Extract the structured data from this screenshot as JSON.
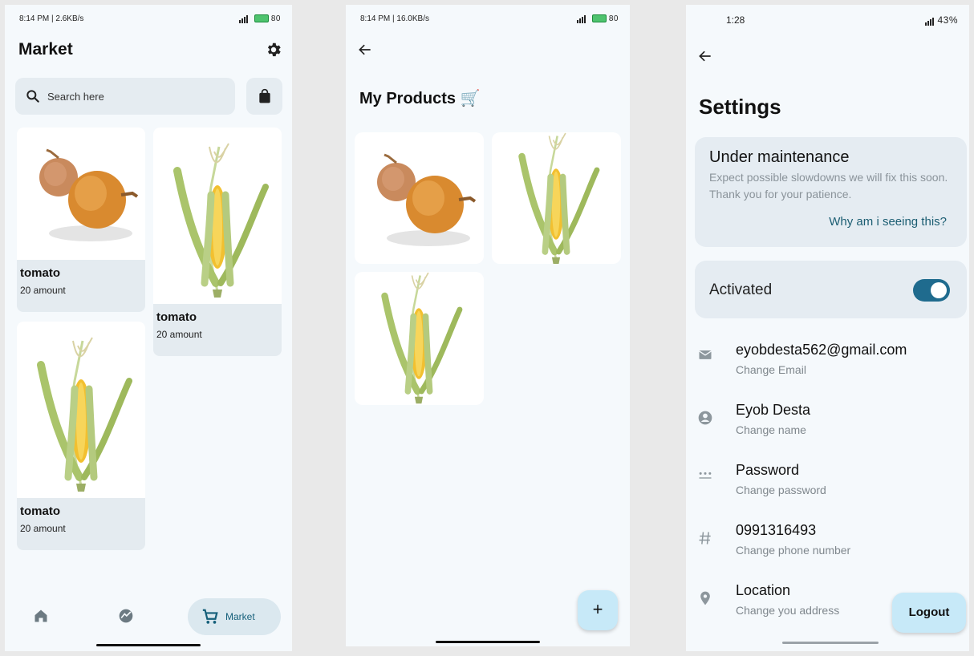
{
  "screens": {
    "market": {
      "status": {
        "left": "8:14 PM | 2.6KB/s",
        "right": "80"
      },
      "title": "Market",
      "search": {
        "placeholder": "Search here"
      },
      "products": [
        {
          "name": "tomato",
          "amount": "20 amount",
          "image": "onion"
        },
        {
          "name": "tomato",
          "amount": "20 amount",
          "image": "corn"
        },
        {
          "name": "tomato",
          "amount": "20 amount",
          "image": "corn"
        }
      ],
      "nav": {
        "active_label": "Market",
        "icons": [
          "home-icon",
          "chart-icon",
          "cart-icon"
        ]
      }
    },
    "my_products": {
      "status": {
        "left": "8:14 PM | 16.0KB/s",
        "right": "80"
      },
      "title": "My Products 🛒",
      "items": [
        "onion",
        "corn",
        "corn"
      ],
      "fab_label": "+"
    },
    "settings": {
      "status": {
        "left": "1:28",
        "right": "43%"
      },
      "title": "Settings",
      "maintenance": {
        "heading": "Under maintenance",
        "description": "Expect possible slowdowns we will fix this soon. Thank you for your patience.",
        "link": "Why am i seeing this?"
      },
      "activated": {
        "label": "Activated",
        "on": true
      },
      "rows": [
        {
          "value": "eyobdesta562@gmail.com",
          "sub": "Change Email",
          "icon": "mail-icon"
        },
        {
          "value": "Eyob Desta",
          "sub": "Change name",
          "icon": "person-icon"
        },
        {
          "value": "Password",
          "sub": "Change password",
          "icon": "password-icon"
        },
        {
          "value": "0991316493",
          "sub": "Change phone number",
          "icon": "hash-icon"
        },
        {
          "value": "Location",
          "sub": "Change you address",
          "icon": "location-icon"
        }
      ],
      "logout": "Logout"
    }
  },
  "colors": {
    "background": "#f5f9fc",
    "card": "#e4ebf0",
    "accent": "#1f6b8e",
    "fab": "#c7e9f8"
  }
}
